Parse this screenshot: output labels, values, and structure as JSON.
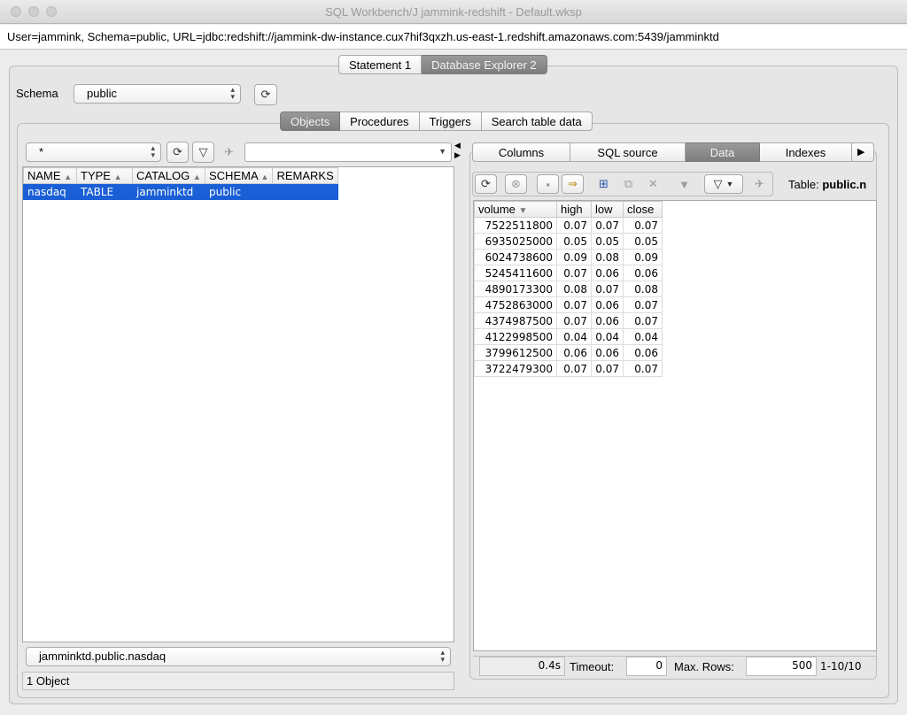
{
  "window": {
    "title": "SQL Workbench/J jammink-redshift - Default.wksp"
  },
  "connection": {
    "info": "User=jammink, Schema=public, URL=jdbc:redshift://jammink-dw-instance.cux7hif3qxzh.us-east-1.redshift.amazonaws.com:5439/jamminktd"
  },
  "main_tabs": [
    {
      "label": "Statement 1"
    },
    {
      "label": "Database Explorer 2"
    }
  ],
  "schema": {
    "label": "Schema",
    "value": "public"
  },
  "object_tabs": [
    {
      "label": "Objects"
    },
    {
      "label": "Procedures"
    },
    {
      "label": "Triggers"
    },
    {
      "label": "Search table data"
    }
  ],
  "filter": {
    "pattern": "*",
    "text": ""
  },
  "object_table": {
    "columns": [
      "NAME",
      "TYPE",
      "CATALOG",
      "SCHEMA",
      "REMARKS"
    ],
    "rows": [
      [
        "nasdaq",
        "TABLE",
        "jamminktd",
        "public",
        ""
      ]
    ]
  },
  "selected_object": "jamminktd.public.nasdaq",
  "object_count": "1 Object",
  "detail_tabs": [
    {
      "label": "Columns"
    },
    {
      "label": "SQL source"
    },
    {
      "label": "Data"
    },
    {
      "label": "Indexes"
    }
  ],
  "table_label": "Table:",
  "table_name": "public.n",
  "data_table": {
    "columns": [
      "volume",
      "high",
      "low",
      "close"
    ],
    "rows": [
      [
        "7522511800",
        "0.07",
        "0.07",
        "0.07"
      ],
      [
        "6935025000",
        "0.05",
        "0.05",
        "0.05"
      ],
      [
        "6024738600",
        "0.09",
        "0.08",
        "0.09"
      ],
      [
        "5245411600",
        "0.07",
        "0.06",
        "0.06"
      ],
      [
        "4890173300",
        "0.08",
        "0.07",
        "0.08"
      ],
      [
        "4752863000",
        "0.07",
        "0.06",
        "0.07"
      ],
      [
        "4374987500",
        "0.07",
        "0.06",
        "0.07"
      ],
      [
        "4122998500",
        "0.04",
        "0.04",
        "0.04"
      ],
      [
        "3799612500",
        "0.06",
        "0.06",
        "0.06"
      ],
      [
        "3722479300",
        "0.07",
        "0.07",
        "0.07"
      ]
    ]
  },
  "status": {
    "time": "0.4s",
    "timeout_label": "Timeout:",
    "timeout_value": "0",
    "maxrows_label": "Max. Rows:",
    "maxrows_value": "500",
    "range": "1-10/10"
  }
}
